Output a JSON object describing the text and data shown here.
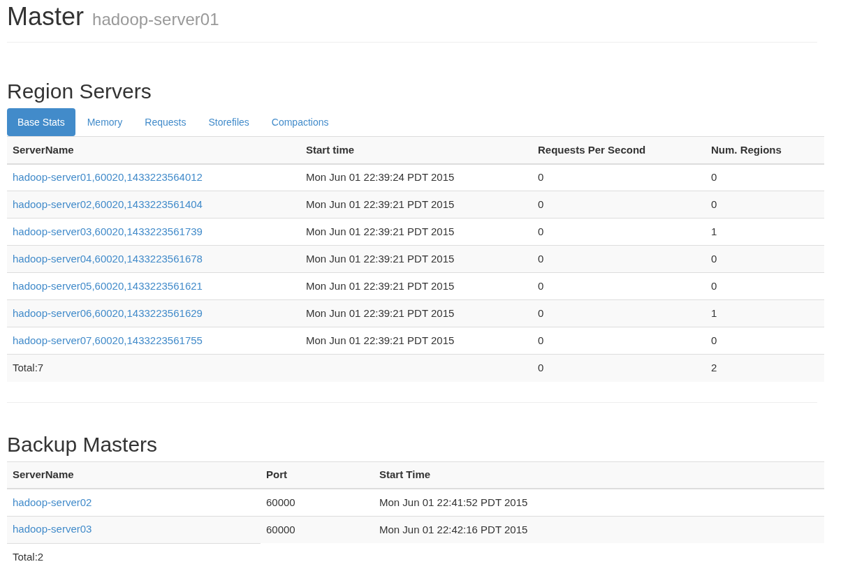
{
  "header": {
    "title": "Master",
    "subtitle": "hadoop-server01"
  },
  "region_servers": {
    "title": "Region Servers",
    "tabs": [
      {
        "label": "Base Stats",
        "selected": true
      },
      {
        "label": "Memory",
        "selected": false
      },
      {
        "label": "Requests",
        "selected": false
      },
      {
        "label": "Storefiles",
        "selected": false
      },
      {
        "label": "Compactions",
        "selected": false
      }
    ],
    "table": {
      "columns": [
        "ServerName",
        "Start time",
        "Requests Per Second",
        "Num. Regions"
      ],
      "rows": [
        [
          "hadoop-server01,60020,1433223564012",
          "Mon Jun 01 22:39:24 PDT 2015",
          "0",
          "0"
        ],
        [
          "hadoop-server02,60020,1433223561404",
          "Mon Jun 01 22:39:21 PDT 2015",
          "0",
          "0"
        ],
        [
          "hadoop-server03,60020,1433223561739",
          "Mon Jun 01 22:39:21 PDT 2015",
          "0",
          "1"
        ],
        [
          "hadoop-server04,60020,1433223561678",
          "Mon Jun 01 22:39:21 PDT 2015",
          "0",
          "0"
        ],
        [
          "hadoop-server05,60020,1433223561621",
          "Mon Jun 01 22:39:21 PDT 2015",
          "0",
          "0"
        ],
        [
          "hadoop-server06,60020,1433223561629",
          "Mon Jun 01 22:39:21 PDT 2015",
          "0",
          "1"
        ],
        [
          "hadoop-server07,60020,1433223561755",
          "Mon Jun 01 22:39:21 PDT 2015",
          "0",
          "0"
        ]
      ],
      "total": {
        "label": "Total:7",
        "requests_per_second": "0",
        "num_regions": "2"
      }
    }
  },
  "backup_masters": {
    "title": "Backup Masters",
    "table": {
      "columns": [
        "ServerName",
        "Port",
        "Start Time"
      ],
      "rows": [
        [
          "hadoop-server02",
          "60000",
          "Mon Jun 01 22:41:52 PDT 2015"
        ],
        [
          "hadoop-server03",
          "60000",
          "Mon Jun 01 22:42:16 PDT 2015"
        ]
      ],
      "total": {
        "label": "Total:2"
      }
    }
  }
}
